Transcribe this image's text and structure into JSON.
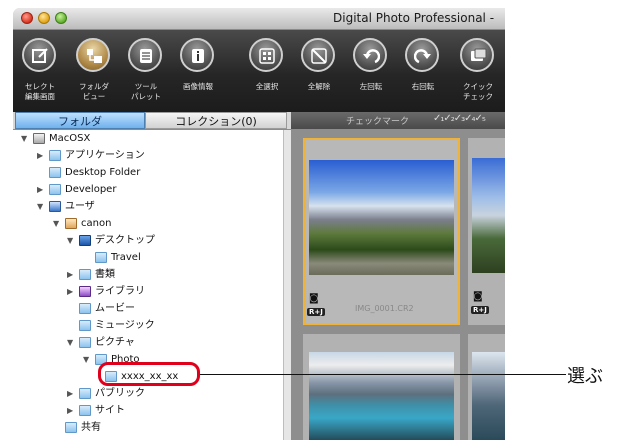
{
  "window": {
    "title": "Digital Photo Professional -"
  },
  "toolbar": {
    "buttons": [
      {
        "label": "セレクト\n編集画面",
        "icon": "select-edit-icon"
      },
      {
        "label": "フォルダ\nビュー",
        "icon": "folder-view-icon"
      },
      {
        "label": "ツール\nパレット",
        "icon": "tool-palette-icon"
      },
      {
        "label": "画像情報",
        "icon": "info-icon"
      },
      {
        "label": "全選択",
        "icon": "select-all-icon"
      },
      {
        "label": "全解除",
        "icon": "deselect-all-icon"
      },
      {
        "label": "左回転",
        "icon": "rotate-left-icon"
      },
      {
        "label": "右回転",
        "icon": "rotate-right-icon"
      },
      {
        "label": "クイック\nチェック",
        "icon": "quick-check-icon"
      }
    ]
  },
  "tabs": {
    "folder": "フォルダ",
    "collection": "コレクション(0)"
  },
  "checkbar": {
    "label": "チェックマーク",
    "marks": "✓₁✓₂✓₃✓₄✓₅"
  },
  "tree": {
    "items": [
      {
        "label": "MacOSX",
        "icon": "drive-icon",
        "expander": "▼"
      },
      {
        "label": "アプリケーション",
        "icon": "folder-icon",
        "expander": "▶"
      },
      {
        "label": "Desktop Folder",
        "icon": "folder-icon",
        "expander": ""
      },
      {
        "label": "Developer",
        "icon": "folder-icon",
        "expander": "▶"
      },
      {
        "label": "ユーザ",
        "icon": "user-icon",
        "expander": "▼"
      },
      {
        "label": "canon",
        "icon": "home-icon",
        "expander": "▼"
      },
      {
        "label": "デスクトップ",
        "icon": "desktop-icon",
        "expander": "▼"
      },
      {
        "label": "Travel",
        "icon": "folder-icon",
        "expander": ""
      },
      {
        "label": "書類",
        "icon": "folder-icon",
        "expander": "▶"
      },
      {
        "label": "ライブラリ",
        "icon": "folder-icon",
        "expander": "▶"
      },
      {
        "label": "ムービー",
        "icon": "folder-icon",
        "expander": ""
      },
      {
        "label": "ミュージック",
        "icon": "folder-icon",
        "expander": ""
      },
      {
        "label": "ピクチャ",
        "icon": "folder-icon",
        "expander": "▼"
      },
      {
        "label": "Photo",
        "icon": "folder-icon",
        "expander": "▼"
      },
      {
        "label": "xxxx_xx_xx",
        "icon": "folder-icon",
        "expander": ""
      },
      {
        "label": "パブリック",
        "icon": "folder-icon",
        "expander": "▶"
      },
      {
        "label": "サイト",
        "icon": "folder-icon",
        "expander": "▶"
      },
      {
        "label": "共有",
        "icon": "folder-icon",
        "expander": ""
      }
    ]
  },
  "viewer": {
    "thumb1_name": "IMG_0001.CR2",
    "raw_badge": "R+J",
    "camera_glyph": "◙"
  },
  "callout": {
    "text": "選ぶ",
    "highlight_color": "#e0001b"
  }
}
